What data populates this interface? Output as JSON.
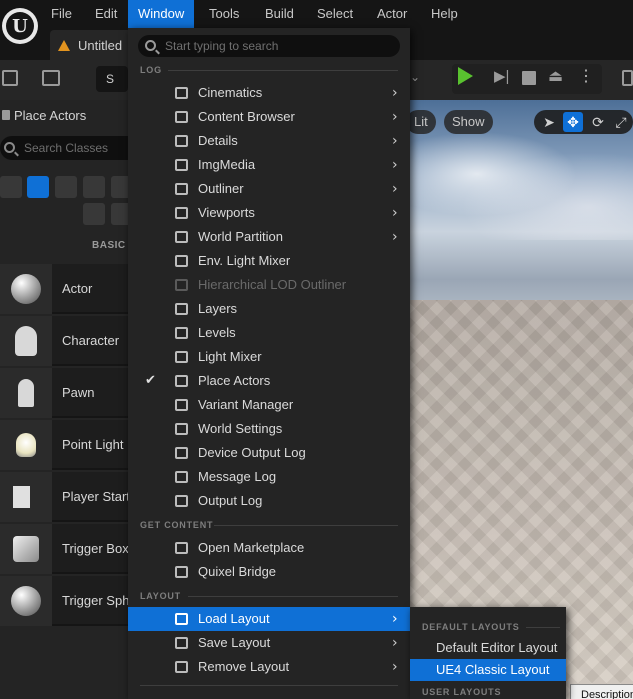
{
  "menubar": {
    "logo": "U",
    "items": [
      "File",
      "Edit",
      "Window",
      "Tools",
      "Build",
      "Select",
      "Actor",
      "Help"
    ],
    "active": "Window"
  },
  "tabs": {
    "document": "Untitled"
  },
  "toolbar": {
    "mode_button": "S"
  },
  "left_panel": {
    "title": "Place Actors",
    "search_placeholder": "Search Classes",
    "category": "BASIC",
    "actors": [
      "Actor",
      "Character",
      "Pawn",
      "Point Light",
      "Player Start",
      "Trigger Box",
      "Trigger Sphere"
    ]
  },
  "viewport": {
    "lit_label": "Lit",
    "show_label": "Show",
    "tooltip": "Description"
  },
  "window_menu": {
    "search_placeholder": "Start typing to search",
    "sections": {
      "log": "LOG",
      "get_content": "GET CONTENT",
      "layout": "LAYOUT"
    },
    "items": [
      {
        "label": "Cinematics",
        "icon": "cinematics-icon"
      },
      {
        "label": "Content Browser",
        "icon": "content-browser-icon"
      },
      {
        "label": "Details",
        "icon": "details-icon"
      },
      {
        "label": "ImgMedia",
        "icon": "imgmedia-icon"
      },
      {
        "label": "Outliner",
        "icon": "outliner-icon"
      },
      {
        "label": "Viewports",
        "icon": "viewports-icon"
      },
      {
        "label": "World Partition",
        "icon": "world-partition-icon"
      },
      {
        "label": "Env. Light Mixer",
        "icon": "env-light-mixer-icon"
      },
      {
        "label": "Hierarchical LOD Outliner",
        "icon": "hlod-outliner-icon"
      },
      {
        "label": "Layers",
        "icon": "layers-icon"
      },
      {
        "label": "Levels",
        "icon": "levels-icon"
      },
      {
        "label": "Light Mixer",
        "icon": "light-mixer-icon"
      },
      {
        "label": "Place Actors",
        "icon": "place-actors-icon"
      },
      {
        "label": "Variant Manager",
        "icon": "variant-manager-icon"
      },
      {
        "label": "World Settings",
        "icon": "world-settings-icon"
      },
      {
        "label": "Device Output Log",
        "icon": "device-output-log-icon"
      },
      {
        "label": "Message Log",
        "icon": "message-log-icon"
      },
      {
        "label": "Output Log",
        "icon": "output-log-icon"
      }
    ],
    "content_items": [
      {
        "label": "Open Marketplace",
        "icon": "marketplace-icon"
      },
      {
        "label": "Quixel Bridge",
        "icon": "quixel-bridge-icon"
      }
    ],
    "layout_items": [
      {
        "label": "Load Layout",
        "icon": "load-layout-icon"
      },
      {
        "label": "Save Layout",
        "icon": "save-layout-icon"
      },
      {
        "label": "Remove Layout",
        "icon": "remove-layout-icon"
      }
    ],
    "checkmark": "✔",
    "submenu_arrow": "›"
  },
  "layout_submenu": {
    "section_default": "DEFAULT LAYOUTS",
    "section_user": "USER LAYOUTS",
    "items": [
      "Default Editor Layout",
      "UE4 Classic Layout"
    ]
  },
  "colors": {
    "accent": "#0f70d6",
    "play": "#59c22f",
    "background": "#151515",
    "menu_bg": "#242424"
  }
}
